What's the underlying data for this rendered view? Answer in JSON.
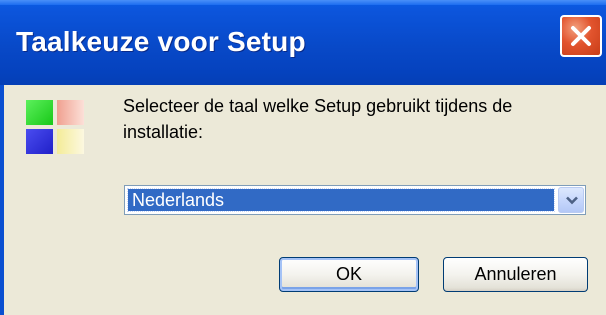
{
  "window": {
    "title": "Taalkeuze voor Setup",
    "close_icon": "close-icon"
  },
  "dialog": {
    "icon": "setup-app-icon",
    "prompt": "Selecteer de taal welke Setup gebruikt tijdens de installatie:",
    "language_select": {
      "selected": "Nederlands",
      "arrow_icon": "chevron-down-icon"
    },
    "buttons": {
      "ok_label": "OK",
      "cancel_label": "Annuleren"
    }
  },
  "colors": {
    "titlebar": "#0a4fd1",
    "dialog_bg": "#ece9d8",
    "selection": "#316ac5",
    "close": "#e2542e"
  }
}
